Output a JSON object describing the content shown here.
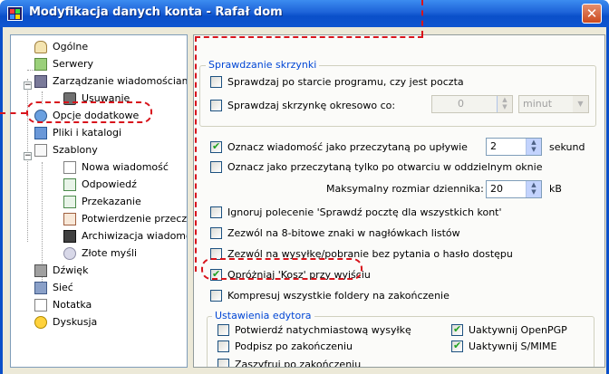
{
  "window": {
    "title": "Modyfikacja danych konta - Rafał dom",
    "close_glyph": "✕"
  },
  "tree": {
    "items": [
      {
        "label": "Ogólne",
        "icon": "general-icon"
      },
      {
        "label": "Serwery",
        "icon": "servers-icon"
      },
      {
        "label": "Zarządzanie wiadomościam",
        "icon": "message-management-icon"
      },
      {
        "label": "Usuwanie",
        "icon": "delete-icon"
      },
      {
        "label": "Opcje dodatkowe",
        "icon": "extra-options-icon"
      },
      {
        "label": "Pliki i katalogi",
        "icon": "folders-icon"
      },
      {
        "label": "Szablony",
        "icon": "templates-icon"
      },
      {
        "label": "Nowa wiadomość",
        "icon": "new-message-icon"
      },
      {
        "label": "Odpowiedź",
        "icon": "reply-icon"
      },
      {
        "label": "Przekazanie",
        "icon": "forward-icon"
      },
      {
        "label": "Potwierdzenie przeczyt",
        "icon": "read-receipt-icon"
      },
      {
        "label": "Archiwizacja wiadomoś",
        "icon": "archive-icon"
      },
      {
        "label": "Złote myśli",
        "icon": "quotes-icon"
      },
      {
        "label": "Dźwięk",
        "icon": "sound-icon"
      },
      {
        "label": "Sieć",
        "icon": "network-icon"
      },
      {
        "label": "Notatka",
        "icon": "note-icon"
      },
      {
        "label": "Dyskusja",
        "icon": "discussion-icon"
      }
    ],
    "expander_minus": "−"
  },
  "mailbox_group": {
    "title": "Sprawdzanie skrzynki",
    "check_on_start": {
      "label": "Sprawdzaj po starcie programu, czy jest poczta",
      "checked": false
    },
    "check_periodically": {
      "label": "Sprawdzaj skrzynkę okresowo co:",
      "checked": false
    },
    "period_value": "0",
    "period_unit": "minut"
  },
  "options": {
    "mark_read_after": {
      "label": "Oznacz wiadomość jako przeczytaną po upływie",
      "checked": true,
      "value": "2",
      "unit": "sekund"
    },
    "mark_read_on_open": {
      "label": "Oznacz jako przeczytaną tylko po otwarciu w oddzielnym oknie",
      "checked": false
    },
    "log_size_label": "Maksymalny rozmiar dziennika:",
    "log_size_value": "20",
    "log_size_unit": "kB",
    "ignore_check_all": {
      "label": "Ignoruj polecenie 'Sprawdź pocztę dla wszystkich kont'",
      "checked": false
    },
    "allow_8bit": {
      "label": "Zezwól na 8-bitowe znaki w nagłówkach listów",
      "checked": false
    },
    "allow_send_receive": {
      "label": "Zezwól na wysyłkę/pobranie bez pytania o hasło dostępu",
      "checked": false
    },
    "empty_trash": {
      "label": "Opróżniaj 'Kosz' przy wyjściu",
      "checked": true
    },
    "compress_folders": {
      "label": "Kompresuj wszystkie foldery na zakończenie",
      "checked": false
    }
  },
  "editor_group": {
    "title": "Ustawienia edytora",
    "confirm_send": {
      "label": "Potwierdź natychmiastową wysyłkę",
      "checked": false
    },
    "enable_openpgp": {
      "label": "Uaktywnij OpenPGP",
      "checked": true
    },
    "sign_on_finish": {
      "label": "Podpisz po zakończeniu",
      "checked": false
    },
    "enable_smime": {
      "label": "Uaktywnij S/MIME",
      "checked": true
    },
    "encrypt_on_finish": {
      "label": "Zaszyfruj po zakończeniu",
      "checked": false
    }
  },
  "colors": {
    "titlebar": "#0a4fc9",
    "annotation": "#d8141c",
    "group_title": "#0046d5"
  }
}
